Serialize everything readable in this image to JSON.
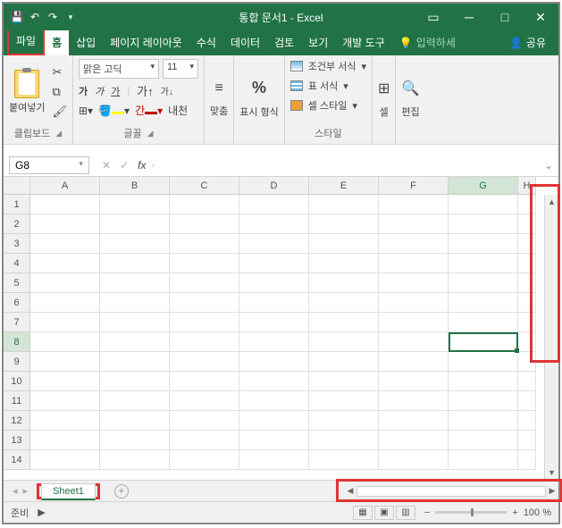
{
  "titlebar": {
    "title": "통합 문서1 - Excel",
    "save_tip": "저장",
    "undo_tip": "실행 취소",
    "redo_tip": "다시 실행"
  },
  "tabs": {
    "file": "파일",
    "home": "홈",
    "insert": "삽입",
    "page_layout": "페이지 레이아웃",
    "formulas": "수식",
    "data": "데이터",
    "review": "검토",
    "view": "보기",
    "developer": "개발 도구",
    "tellme": "입력하세",
    "share": "공유"
  },
  "ribbon": {
    "clipboard": {
      "paste": "붙여넣기",
      "label": "클립보드"
    },
    "font": {
      "name": "맑은 고딕",
      "size": "11",
      "bold": "가",
      "italic": "가",
      "underline": "가",
      "ruby": "내천",
      "label": "글꼴",
      "font_color": "#c00000",
      "fill_color": "#ffff00"
    },
    "align": {
      "label": "맞춤"
    },
    "number": {
      "symbol": "%",
      "label": "표시 형식"
    },
    "styles": {
      "cond": "조건부 서식",
      "table": "표 서식",
      "cell": "셀 스타일",
      "label": "스타일"
    },
    "cells": {
      "label": "셀"
    },
    "editing": {
      "label": "편집"
    }
  },
  "namebox": "G8",
  "columns": [
    "A",
    "B",
    "C",
    "D",
    "E",
    "F",
    "G",
    "H"
  ],
  "rows": [
    "1",
    "2",
    "3",
    "4",
    "5",
    "6",
    "7",
    "8",
    "9",
    "10",
    "11",
    "12",
    "13",
    "14"
  ],
  "active_cell": {
    "col": "G",
    "row": "8"
  },
  "sheet": {
    "name": "Sheet1"
  },
  "status": {
    "ready": "준비",
    "zoom": "100 %"
  }
}
